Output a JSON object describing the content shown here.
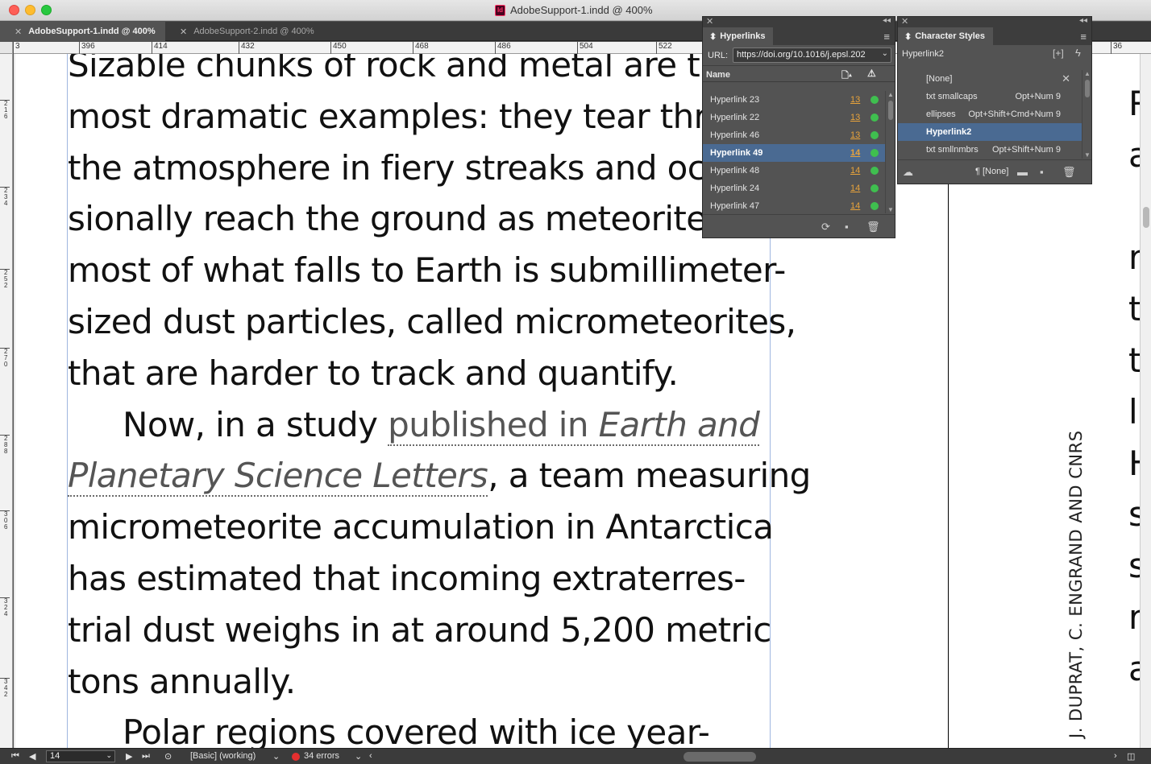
{
  "window": {
    "title": "AdobeSupport-1.indd @ 400%",
    "app_icon": "Id"
  },
  "tabs": [
    {
      "label": "AdobeSupport-1.indd @ 400%",
      "active": true
    },
    {
      "label": "AdobeSupport-2.indd @ 400%",
      "active": false
    }
  ],
  "ruler": {
    "horizontal": [
      "3",
      "396",
      "414",
      "432",
      "450",
      "468",
      "486",
      "504",
      "522",
      "36"
    ],
    "vertical": [
      "216",
      "234",
      "252",
      "270",
      "288",
      "306",
      "324",
      "342"
    ]
  },
  "document": {
    "lines": [
      "Sizable chunks of rock and metal are the",
      "most dramatic examples: they tear thro",
      "the atmosphere in fiery streaks and occa-",
      "sionally reach the ground as meteorites.",
      "most of what falls to Earth is submillimeter-",
      "sized dust particles, called micrometeorites,",
      "that are harder to track and quantify."
    ],
    "para2_start": "Now, in a study ",
    "link_text_1": "published in ",
    "link_text_italic_1": "Earth and",
    "link_text_italic_2": "Planetary Science Letters",
    "para2_after_link": ", a team measuring",
    "para2_lines": [
      "micrometeorite accumulation in Antarctica",
      "has estimated that incoming extraterres-",
      "trial dust weighs in at around 5,200 metric",
      "tons annually."
    ],
    "para3_start": "Polar regions covered with ice year-",
    "right_column": [
      "R",
      "a",
      "",
      "r",
      "t",
      "t",
      "l",
      "H",
      "s",
      "s",
      "r",
      "a"
    ],
    "photo_credit": "J. DUPRAT, C. ENGRAND AND CNRS"
  },
  "hyperlinks_panel": {
    "title": "Hyperlinks",
    "url_label": "URL:",
    "url_value": "https://doi.org/10.1016/j.epsl.202",
    "column_name": "Name",
    "rows": [
      {
        "name": "Hyperlink 23",
        "page": "13",
        "status": "ok",
        "selected": false
      },
      {
        "name": "Hyperlink 22",
        "page": "13",
        "status": "ok",
        "selected": false
      },
      {
        "name": "Hyperlink 46",
        "page": "13",
        "status": "ok",
        "selected": false
      },
      {
        "name": "Hyperlink 49",
        "page": "14",
        "status": "ok",
        "selected": true
      },
      {
        "name": "Hyperlink 48",
        "page": "14",
        "status": "ok",
        "selected": false
      },
      {
        "name": "Hyperlink 24",
        "page": "14",
        "status": "ok",
        "selected": false
      },
      {
        "name": "Hyperlink 47",
        "page": "14",
        "status": "ok",
        "selected": false
      }
    ],
    "status_color": "#3fbf4f",
    "page_link_color": "#e8a33b"
  },
  "character_styles_panel": {
    "title": "Character Styles",
    "current_style": "Hyperlink2",
    "rows": [
      {
        "name": "[None]",
        "shortcut": "",
        "selected": false
      },
      {
        "name": "txt smallcaps",
        "shortcut": "Opt+Num 9",
        "selected": false
      },
      {
        "name": "ellipses",
        "shortcut": "Opt+Shift+Cmd+Num 9",
        "selected": false
      },
      {
        "name": "Hyperlink2",
        "shortcut": "",
        "selected": true
      },
      {
        "name": "txt smllnmbrs",
        "shortcut": "Opt+Shift+Num 9",
        "selected": false
      }
    ],
    "footer_style": "¶ [None]"
  },
  "status_bar": {
    "page_number": "14",
    "preflight_profile": "[Basic] (working)",
    "errors": "34 errors",
    "error_color": "#e52f2f"
  },
  "colors": {
    "selection": "#4a6a92",
    "panel_bg": "#535353",
    "margin_guide": "#9fb6df"
  }
}
